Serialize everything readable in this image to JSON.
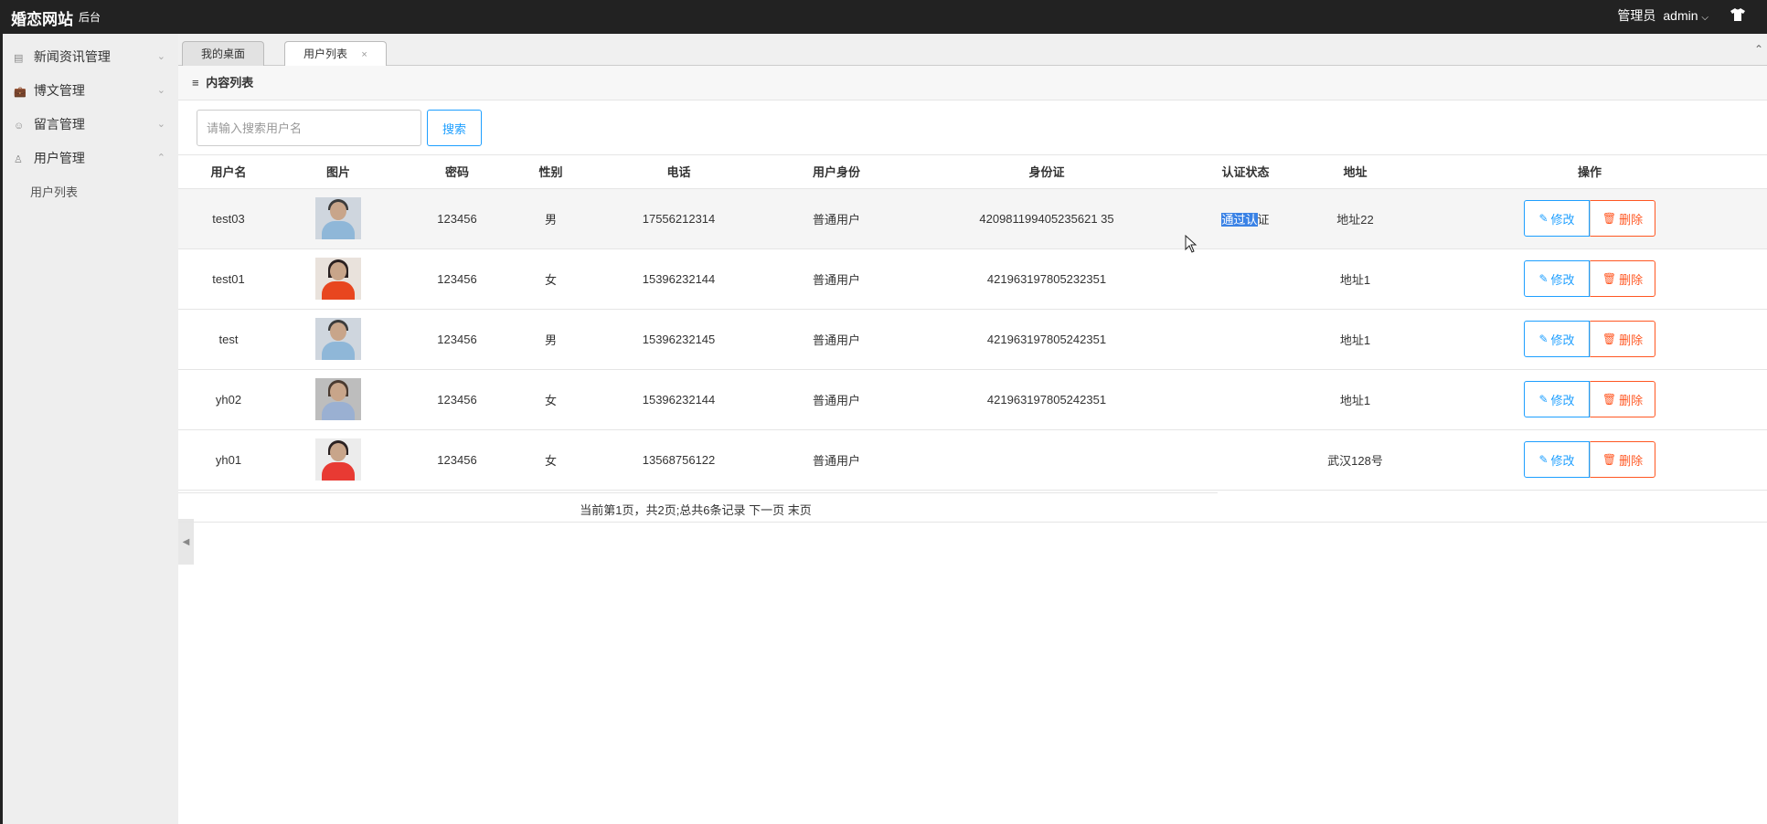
{
  "header": {
    "brand": "婚恋网站",
    "brand_sub": "后台",
    "role_label": "管理员",
    "user": "admin",
    "user_chevron": "chevron-down-icon",
    "skin_icon": "tshirt-icon"
  },
  "sidebar": {
    "items": [
      {
        "label": "新闻资讯管理",
        "icon": "newspaper-icon",
        "arrow": "chevron-down"
      },
      {
        "label": "博文管理",
        "icon": "bag-icon",
        "arrow": "chevron-down"
      },
      {
        "label": "留言管理",
        "icon": "comment-icon",
        "arrow": "chevron-down"
      },
      {
        "label": "用户管理",
        "icon": "user-icon",
        "arrow": "chevron-up"
      }
    ],
    "subitems": [
      {
        "label": "用户列表"
      }
    ]
  },
  "tabs": [
    {
      "label": "我的桌面",
      "closable": false
    },
    {
      "label": "用户列表",
      "closable": true,
      "close_glyph": "×"
    }
  ],
  "panel": {
    "title": "内容列表"
  },
  "search": {
    "placeholder": "请输入搜索用户名",
    "value": "",
    "button": "搜索"
  },
  "table": {
    "headers": [
      "用户名",
      "图片",
      "密码",
      "性别",
      "电话",
      "用户身份",
      "身份证",
      "认证状态",
      "地址",
      "操作"
    ],
    "rows": [
      {
        "username": "test03",
        "photo": "m",
        "password": "123456",
        "gender": "男",
        "phone": "17556212314",
        "role": "普通用户",
        "id_card": "420981199405235621 35",
        "auth_selected": "通过认",
        "auth_rest": "证",
        "address": "地址22"
      },
      {
        "username": "test01",
        "photo": "f1",
        "password": "123456",
        "gender": "女",
        "phone": "15396232144",
        "role": "普通用户",
        "id_card": "421963197805232351",
        "auth_selected": "",
        "auth_rest": "",
        "address": "地址1"
      },
      {
        "username": "test",
        "photo": "m",
        "password": "123456",
        "gender": "男",
        "phone": "15396232145",
        "role": "普通用户",
        "id_card": "421963197805242351",
        "auth_selected": "",
        "auth_rest": "",
        "address": "地址1"
      },
      {
        "username": "yh02",
        "photo": "f2",
        "password": "123456",
        "gender": "女",
        "phone": "15396232144",
        "role": "普通用户",
        "id_card": "421963197805242351",
        "auth_selected": "",
        "auth_rest": "",
        "address": "地址1"
      },
      {
        "username": "yh01",
        "photo": "f3",
        "password": "123456",
        "gender": "女",
        "phone": "13568756122",
        "role": "普通用户",
        "id_card": "",
        "auth_selected": "",
        "auth_rest": "",
        "address": "武汉128号"
      }
    ],
    "edit_label": "修改",
    "delete_label": "删除"
  },
  "pager": {
    "text": "当前第1页，共2页;总共6条记录 下一页 末页"
  },
  "colors": {
    "topbar": "#222222",
    "sidebar": "#eeeeee",
    "primary": "#1e9fff",
    "danger": "#ff5722",
    "selection": "#3a82e5"
  }
}
